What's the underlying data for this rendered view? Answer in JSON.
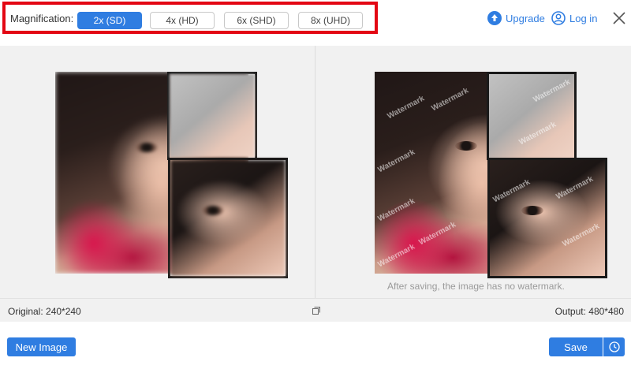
{
  "magnification": {
    "label": "Magnification:",
    "options": [
      "2x (SD)",
      "4x (HD)",
      "6x (SHD)",
      "8x (UHD)"
    ],
    "selected": "2x (SD)",
    "highlight_color": "#e30613"
  },
  "header": {
    "upgrade_label": "Upgrade",
    "login_label": "Log in"
  },
  "preview": {
    "watermark_text": "Watermark",
    "note": "After saving, the image has no watermark."
  },
  "info": {
    "original": "Original: 240*240",
    "output": "Output: 480*480"
  },
  "actions": {
    "new_image_label": "New Image",
    "save_label": "Save"
  },
  "colors": {
    "accent": "#2f7de1",
    "panel_bg": "#f1f1f1"
  },
  "icons": [
    "upgrade-icon",
    "user-icon",
    "close-icon",
    "compare-icon",
    "history-clock-icon"
  ]
}
